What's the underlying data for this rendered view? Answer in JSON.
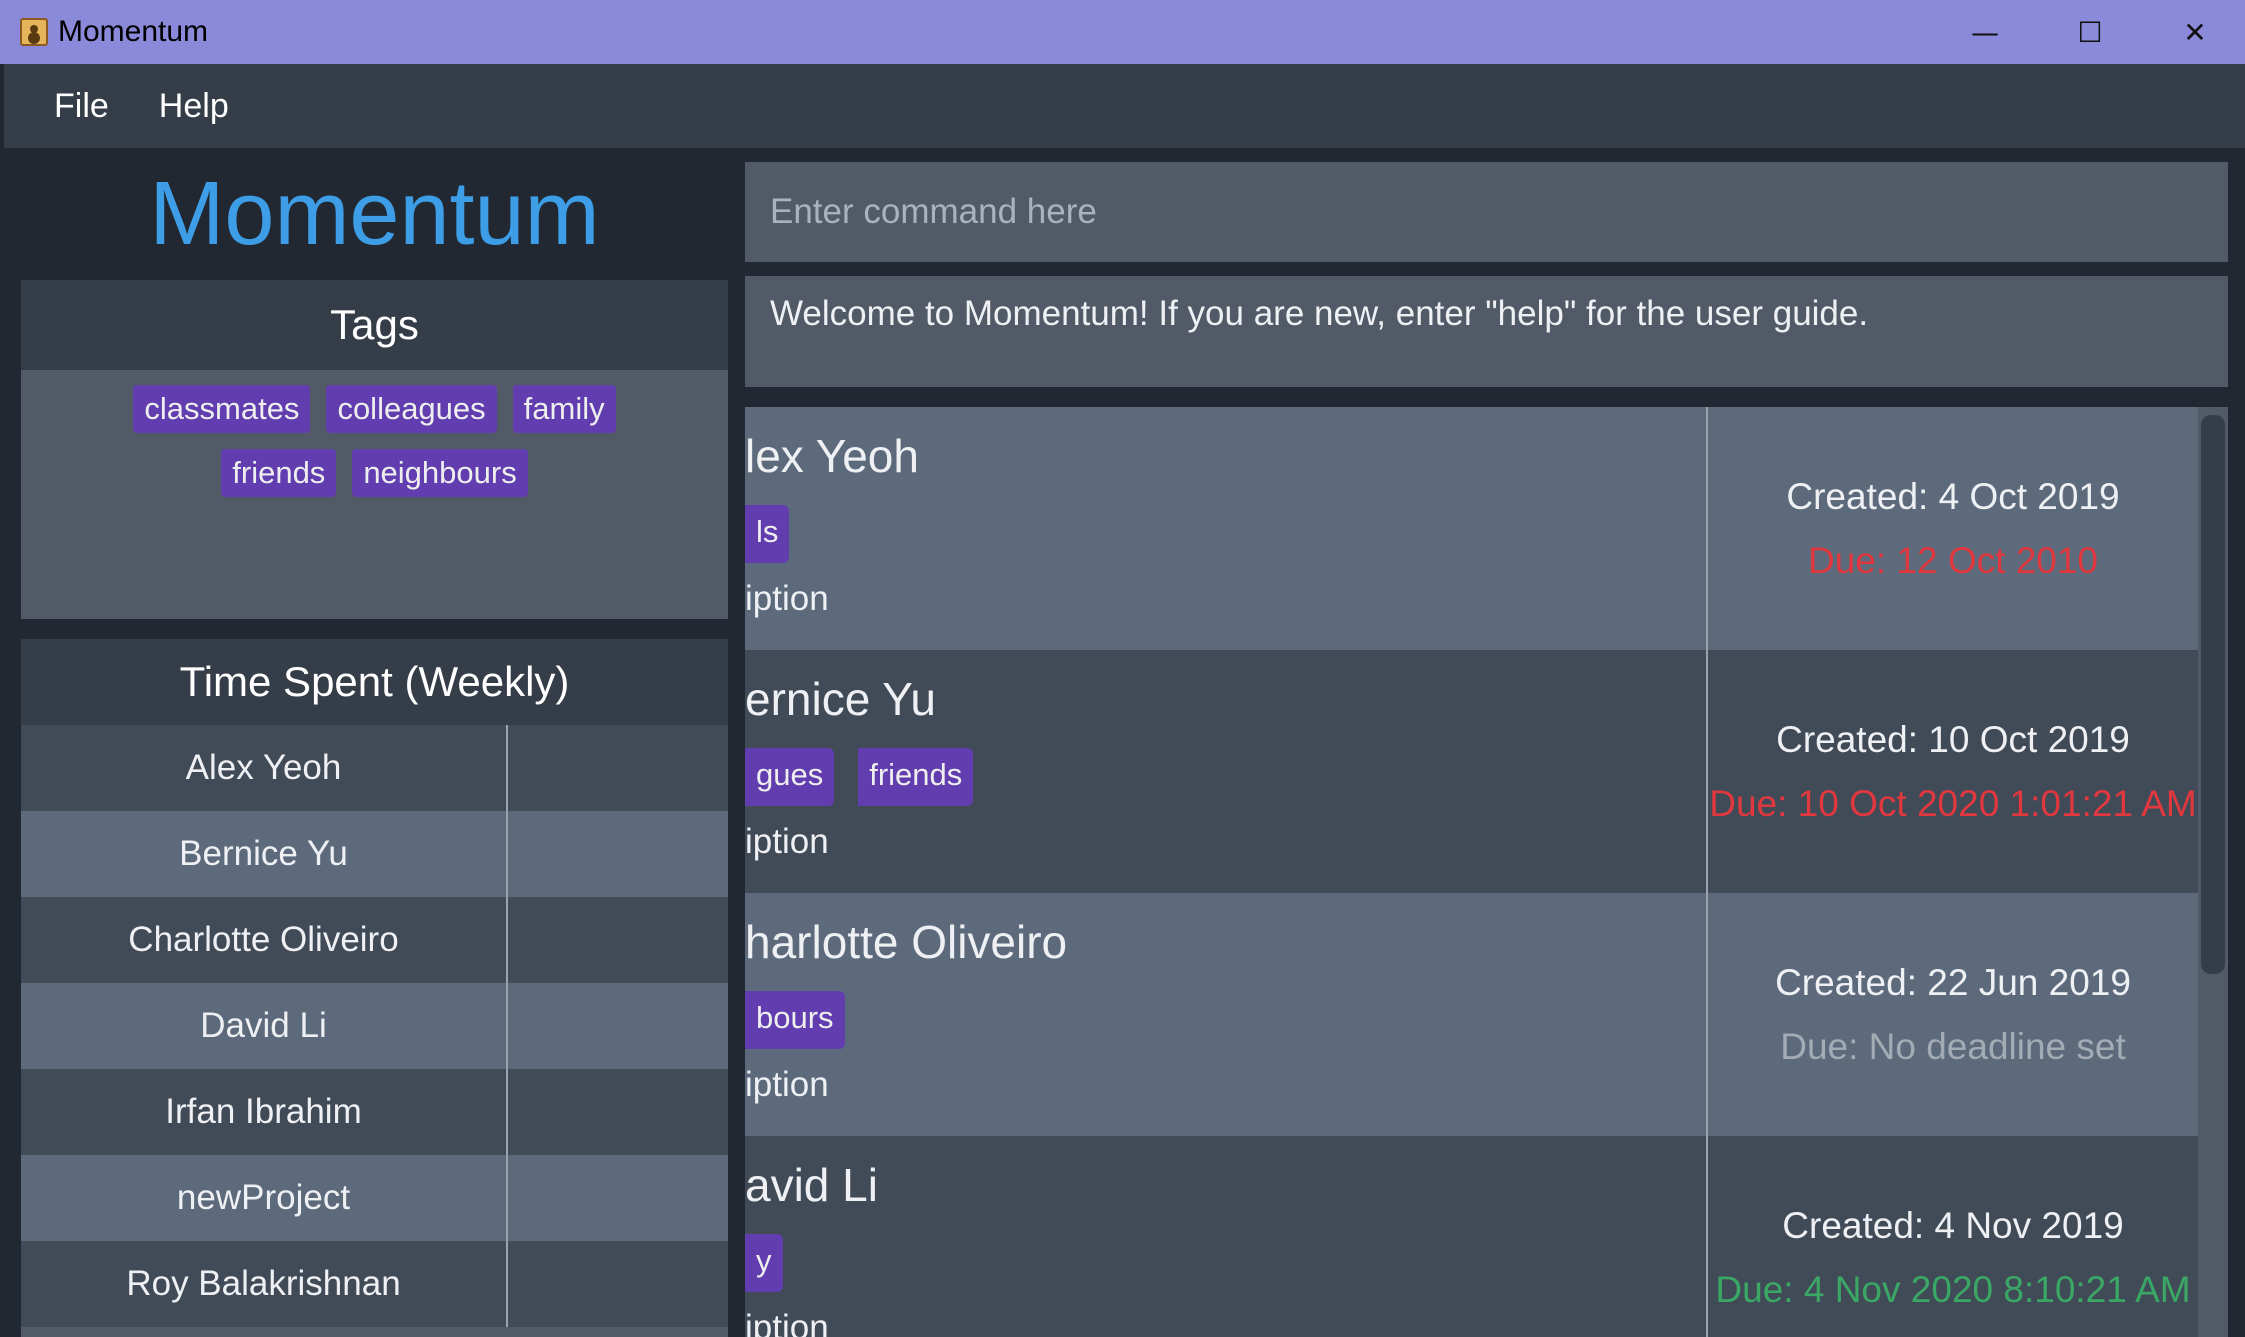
{
  "window": {
    "title": "Momentum",
    "minimize": "—",
    "maximize": "☐",
    "close": "✕"
  },
  "menu": [
    "File",
    "Help"
  ],
  "logo": "Momentum",
  "tags": {
    "header": "Tags",
    "items": [
      "classmates",
      "colleagues",
      "family",
      "friends",
      "neighbours"
    ]
  },
  "time_spent": {
    "header": "Time Spent (Weekly)",
    "rows": [
      "Alex Yeoh",
      "Bernice Yu",
      "Charlotte Oliveiro",
      "David Li",
      "Irfan Ibrahim",
      "newProject",
      "Roy Balakrishnan"
    ]
  },
  "command": {
    "placeholder": "Enter command here",
    "value": ""
  },
  "result": "Welcome to Momentum! If you are new, enter \"help\" for the user guide.",
  "projects": [
    {
      "name": "lex Yeoh",
      "tags": [
        "ls"
      ],
      "desc": "iption",
      "created": "Created: 4 Oct 2019",
      "due": "Due: 12 Oct 2010",
      "due_color": "#e0383e"
    },
    {
      "name": "ernice Yu",
      "tags": [
        "gues",
        "friends"
      ],
      "desc": "iption",
      "created": "Created: 10 Oct 2019",
      "due": "Due: 10 Oct 2020 1:01:21 AM",
      "due_color": "#e0383e"
    },
    {
      "name": "harlotte Oliveiro",
      "tags": [
        "bours"
      ],
      "desc": "iption",
      "created": "Created: 22 Jun 2019",
      "due": "Due: No deadline set",
      "due_color": "#a3abb5"
    },
    {
      "name": "avid Li",
      "tags": [
        "y"
      ],
      "desc": "iption",
      "created": "Created: 4 Nov 2019",
      "due": "Due: 4 Nov 2020 8:10:21 AM",
      "due_color": "#3aa864"
    }
  ]
}
